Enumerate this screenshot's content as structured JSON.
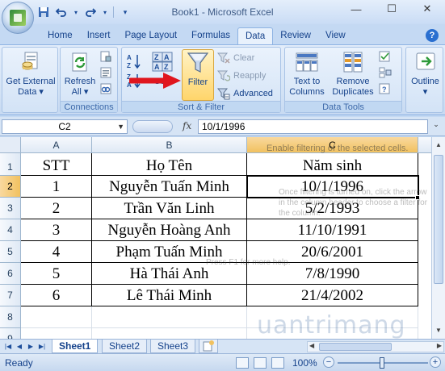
{
  "window": {
    "title": "Book1 - Microsoft Excel",
    "minimize_glyph": "—",
    "maximize_glyph": "☐",
    "close_glyph": "✕"
  },
  "ribbon_tabs": [
    {
      "label": "Home",
      "active": false
    },
    {
      "label": "Insert",
      "active": false
    },
    {
      "label": "Page Layout",
      "active": false
    },
    {
      "label": "Formulas",
      "active": false
    },
    {
      "label": "Data",
      "active": true
    },
    {
      "label": "Review",
      "active": false
    },
    {
      "label": "View",
      "active": false
    }
  ],
  "ribbon": {
    "get_external_data": {
      "line1": "Get External",
      "line2": "Data ▾"
    },
    "connections": {
      "refresh_line1": "Refresh",
      "refresh_line2": "All ▾",
      "group_label": "Connections"
    },
    "sort_filter": {
      "sort_label": "Sort",
      "filter_label": "Filter",
      "clear_label": "Clear",
      "reapply_label": "Reapply",
      "advanced_label": "Advanced",
      "group_label": "Sort & Filter"
    },
    "data_tools": {
      "text_to_columns_line1": "Text to",
      "text_to_columns_line2": "Columns",
      "remove_duplicates_line1": "Remove",
      "remove_duplicates_line2": "Duplicates",
      "group_label": "Data Tools"
    },
    "outline": {
      "label": "Outline",
      "arrow": "▾"
    }
  },
  "formula_bar": {
    "name_box": "C2",
    "fx": "fx",
    "value": "10/1/1996"
  },
  "columns": [
    "A",
    "B",
    "C"
  ],
  "rows": [
    "1",
    "2",
    "3",
    "4",
    "5",
    "6",
    "7",
    "8",
    "9"
  ],
  "table": {
    "header": [
      "STT",
      "Họ Tên",
      "Năm sinh"
    ],
    "rows": [
      [
        "1",
        "Nguyễn Tuấn Minh",
        "10/1/1996"
      ],
      [
        "2",
        "Trần Văn Linh",
        "5/2/1993"
      ],
      [
        "3",
        "Nguyễn Hoàng Anh",
        "11/10/1991"
      ],
      [
        "4",
        "Phạm Tuấn Minh",
        "20/6/2001"
      ],
      [
        "5",
        "Hà Thái Anh",
        "7/8/1990"
      ],
      [
        "6",
        "Lê Thái Minh",
        "21/4/2002"
      ]
    ]
  },
  "tooltip": {
    "title": "Enable filtering of the selected cells.",
    "body": "Once filtering is turned on, click the arrow in the column header to choose a filter for the column.",
    "help": "Press F1 for more help."
  },
  "sheets": [
    {
      "label": "Sheet1",
      "active": true
    },
    {
      "label": "Sheet2",
      "active": false
    },
    {
      "label": "Sheet3",
      "active": false
    }
  ],
  "status": {
    "ready": "Ready",
    "zoom": "100%",
    "minus": "−",
    "plus": "+"
  },
  "watermark": "uantrimang",
  "accent_colors": {
    "ribbon_bg": "#d5e4f6",
    "selected_header": "#f1c15f",
    "red_arrow": "#e0161e"
  }
}
